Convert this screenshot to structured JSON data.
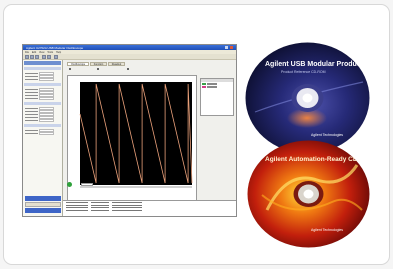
{
  "app": {
    "title": "Agilent U2702A USB Modular Oscilloscope",
    "menus": [
      "File",
      "Edit",
      "View",
      "Tools",
      "Help"
    ],
    "tabs": [
      "Oscilloscope",
      "Function",
      "Readout"
    ],
    "waveform_color": "#e9a07a",
    "trace_color": "#000000"
  },
  "cd_top": {
    "title": "Agilent USB Modular Products",
    "subtitle": "Product Reference CD-ROM",
    "brand": "Agilent Technologies"
  },
  "cd_bottom": {
    "title": "Agilent Automation-Ready CD",
    "brand": "Agilent Technologies"
  },
  "colors": {
    "cd_top_base": "#1b1e4a",
    "cd_bottom_base": "#8b0c0a",
    "window_title": "#2456c6"
  }
}
